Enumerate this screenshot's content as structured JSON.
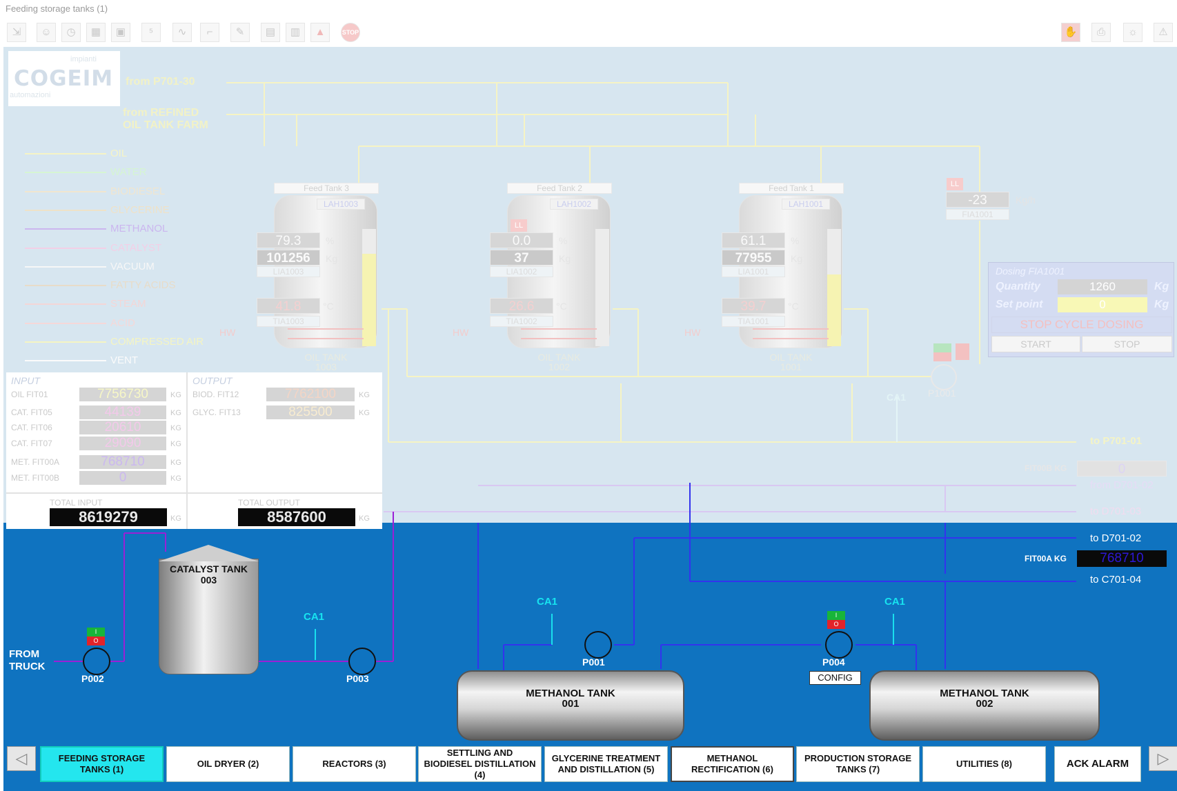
{
  "window": {
    "title": "Feeding storage tanks (1)"
  },
  "toolbar": {
    "left_icons": [
      "login-icon",
      "users-icon",
      "clock-icon",
      "calculator-icon",
      "print-icon",
      "counter-icon",
      "trend-icon",
      "recipe-icon",
      "report-icon",
      "screen-icon",
      "table-icon",
      "alarm-icon",
      "stop-icon"
    ],
    "stop_label": "STOP",
    "right_icons": [
      "hand-icon",
      "printer-icon",
      "sun-icon",
      "warning-icon"
    ]
  },
  "logo": {
    "top": "impianti",
    "main": "COGEIM",
    "bottom": "automazioni"
  },
  "feeds": {
    "p701": "from P701-30",
    "refined_1": "from REFINED",
    "refined_2": "OIL TANK FARM"
  },
  "legend": [
    {
      "label": "OIL",
      "color": "#f6f4c6"
    },
    {
      "label": "WATER",
      "color": "#d6f5d2"
    },
    {
      "label": "BIODIESEL",
      "color": "#f1e6cf"
    },
    {
      "label": "GLYCERINE",
      "color": "#efe2c8"
    },
    {
      "label": "METHANOL",
      "color": "#cbb6ef"
    },
    {
      "label": "CATALYST",
      "color": "#f3cfe6"
    },
    {
      "label": "VACUUM",
      "color": "#f7f7f7"
    },
    {
      "label": "FATTY ACIDS",
      "color": "#e8dcc8"
    },
    {
      "label": "STEAM",
      "color": "#f4d6d6"
    },
    {
      "label": "ACID",
      "color": "#f5d8d8"
    },
    {
      "label": "COMPRESSED AIR",
      "color": "#f5f5c2"
    },
    {
      "label": "VENT",
      "color": "#fbfbfb"
    }
  ],
  "tanks": [
    {
      "name": "Feed Tank 3",
      "lah": "LAH1003",
      "level": "79.3",
      "level_unit": "%",
      "weight": "101256",
      "weight_unit": "Kg",
      "lia": "LIA1003",
      "temp": "41.8",
      "temp_unit": "°C",
      "tia": "TIA1003",
      "hw": "HW",
      "caption_1": "OIL TANK",
      "caption_2": "1003",
      "fill": 0.79,
      "alarm": ""
    },
    {
      "name": "Feed Tank 2",
      "lah": "LAH1002",
      "level": "0.0",
      "level_unit": "%",
      "weight": "37",
      "weight_unit": "Kg",
      "lia": "LIA1002",
      "temp": "26.6",
      "temp_unit": "°C",
      "tia": "TIA1002",
      "hw": "HW",
      "caption_1": "OIL TANK",
      "caption_2": "1002",
      "fill": 0.0,
      "alarm": "LL"
    },
    {
      "name": "Feed Tank 1",
      "lah": "LAH1001",
      "level": "61.1",
      "level_unit": "%",
      "weight": "77955",
      "weight_unit": "Kg",
      "lia": "LIA1001",
      "temp": "39.7",
      "temp_unit": "°C",
      "tia": "TIA1001",
      "hw": "HW",
      "caption_1": "OIL TANK",
      "caption_2": "1001",
      "fill": 0.61,
      "alarm": ""
    }
  ],
  "fia": {
    "alarm": "LL",
    "value": "-23",
    "unit": "Kg/h",
    "tag": "FIA1001"
  },
  "dosing": {
    "title": "Dosing FIA1001",
    "quantity_label": "Quantity",
    "quantity": "1260",
    "quantity_unit": "Kg",
    "setpoint_label": "Set point",
    "setpoint": "0",
    "setpoint_unit": "Kg",
    "stop_cycle": "STOP CYCLE DOSING",
    "start": "START",
    "stop": "STOP"
  },
  "pump_p1001": "P1001",
  "ca1": "CA1",
  "to_p701": "to P701-01",
  "fit00b": {
    "label": "FIT00B KG",
    "value": "0"
  },
  "from_d701": "from D701-02",
  "to_d701_03": "to D701-03",
  "to_d701_02": "to D701-02",
  "fit00a": {
    "label": "FIT00A KG",
    "value": "768710"
  },
  "to_c701": "to C701-04",
  "totals": {
    "input_title": "INPUT",
    "output_title": "OUTPUT",
    "inputs": [
      {
        "label": "OIL FIT01",
        "value": "7756730",
        "unit": "KG",
        "color": "#f7f7c6"
      },
      {
        "label": "CAT. FIT05",
        "value": "44139",
        "unit": "KG",
        "color": "#f3c9ea"
      },
      {
        "label": "CAT. FIT06",
        "value": "20610",
        "unit": "KG",
        "color": "#f3c9ea"
      },
      {
        "label": "CAT. FIT07",
        "value": "29090",
        "unit": "KG",
        "color": "#f3c9ea"
      },
      {
        "label": "MET. FIT00A",
        "value": "768710",
        "unit": "KG",
        "color": "#cbb8f0"
      },
      {
        "label": "MET. FIT00B",
        "value": "0",
        "unit": "KG",
        "color": "#cbb8f0"
      }
    ],
    "outputs": [
      {
        "label": "BIOD. FIT12",
        "value": "7762100",
        "unit": "KG",
        "color": "#f3d5c6"
      },
      {
        "label": "GLYC. FIT13",
        "value": "825500",
        "unit": "KG",
        "color": "#f8ecd0"
      }
    ],
    "total_input_label": "TOTAL INPUT",
    "total_input": "8619279",
    "total_input_unit": "KG",
    "total_output_label": "TOTAL OUTPUT",
    "total_output": "8587600",
    "total_output_unit": "KG"
  },
  "lower": {
    "from_truck_1": "FROM",
    "from_truck_2": "TRUCK",
    "p002": "P002",
    "p003": "P003",
    "p001": "P001",
    "p004": "P004",
    "catalyst_1": "CATALYST TANK",
    "catalyst_2": "003",
    "meth1_1": "METHANOL TANK",
    "meth1_2": "001",
    "meth2_1": "METHANOL TANK",
    "meth2_2": "002",
    "config": "CONFIG",
    "io_i": "I",
    "io_o": "O"
  },
  "nav": {
    "prev": "◁",
    "next": "▷",
    "buttons": [
      {
        "label": "FEEDING STORAGE TANKS (1)"
      },
      {
        "label": "OIL DRYER (2)"
      },
      {
        "label": "REACTORS (3)"
      },
      {
        "label": "SETTLING AND BIODIESEL DISTILLATION (4)"
      },
      {
        "label": "GLYCERINE TREATMENT AND DISTILLATION (5)"
      },
      {
        "label": "METHANOL RECTIFICATION (6)"
      },
      {
        "label": "PRODUCTION STORAGE TANKS (7)"
      },
      {
        "label": "UTILITIES (8)"
      }
    ],
    "ack": "ACK ALARM"
  }
}
